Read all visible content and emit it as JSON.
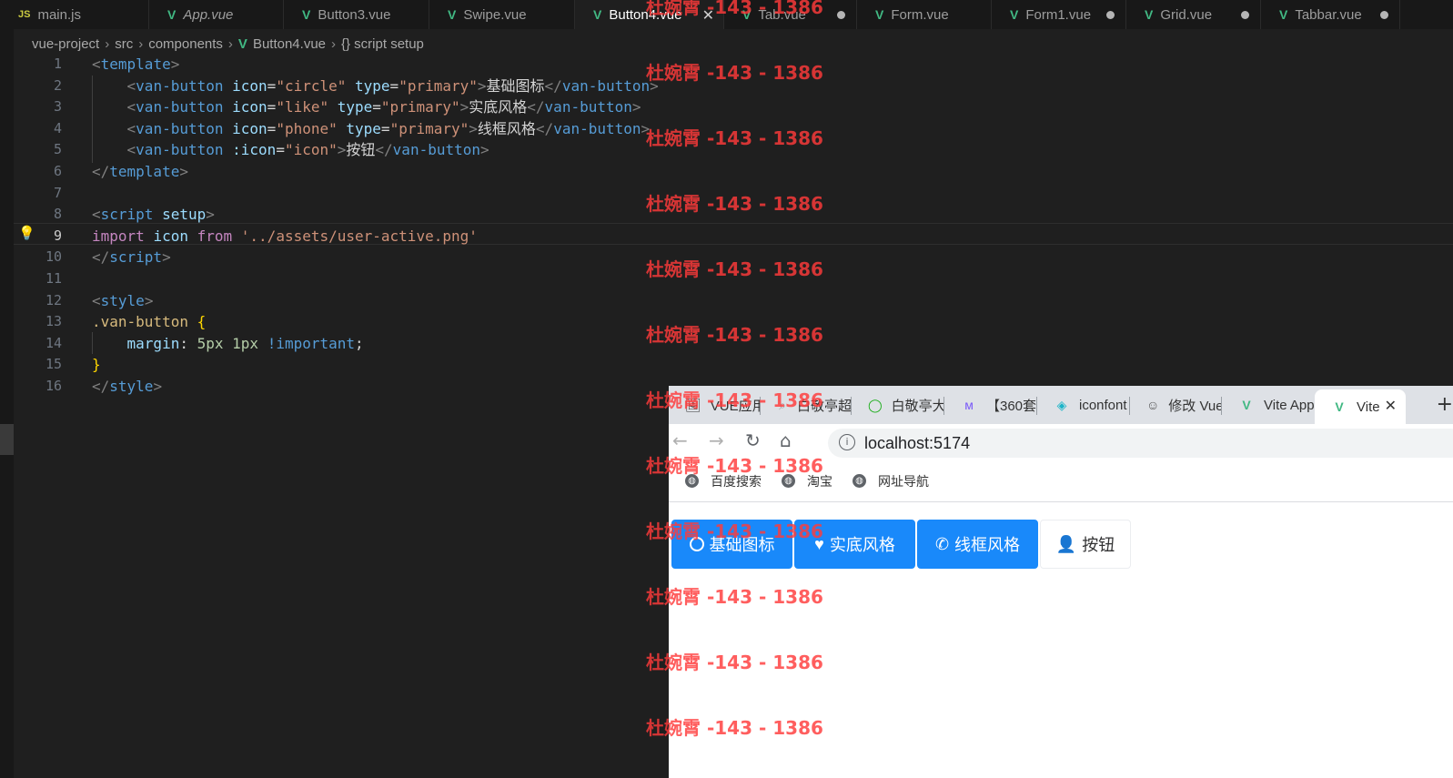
{
  "editor_tabs": [
    {
      "label": "main.js",
      "icon": "js-icon",
      "italic": false,
      "active": false,
      "modified": false
    },
    {
      "label": "App.vue",
      "icon": "vue-icon",
      "italic": true,
      "active": false,
      "modified": false
    },
    {
      "label": "Button3.vue",
      "icon": "vue-icon",
      "italic": false,
      "active": false,
      "modified": false
    },
    {
      "label": "Swipe.vue",
      "icon": "vue-icon",
      "italic": false,
      "active": false,
      "modified": false
    },
    {
      "label": "Button4.vue",
      "icon": "vue-icon",
      "italic": false,
      "active": true,
      "modified": false
    },
    {
      "label": "Tab.vue",
      "icon": "vue-icon",
      "italic": false,
      "active": false,
      "modified": true
    },
    {
      "label": "Form.vue",
      "icon": "vue-icon",
      "italic": false,
      "active": false,
      "modified": false
    },
    {
      "label": "Form1.vue",
      "icon": "vue-icon",
      "italic": false,
      "active": false,
      "modified": true
    },
    {
      "label": "Grid.vue",
      "icon": "vue-icon",
      "italic": false,
      "active": false,
      "modified": true
    },
    {
      "label": "Tabbar.vue",
      "icon": "vue-icon",
      "italic": false,
      "active": false,
      "modified": true
    }
  ],
  "js_icon_text": "JS",
  "vue_icon_text": "V",
  "breadcrumb": {
    "parts": [
      "vue-project",
      "src",
      "components",
      "Button4.vue",
      "{} script setup"
    ]
  },
  "code": {
    "current_line": 9,
    "lines": [
      [
        [
          "tg",
          "<"
        ],
        [
          "tn",
          "template"
        ],
        [
          "tg",
          ">"
        ]
      ],
      [
        [
          "tx",
          "    "
        ],
        [
          "tg",
          "<"
        ],
        [
          "tn",
          "van-button"
        ],
        [
          "tx",
          " "
        ],
        [
          "at",
          "icon"
        ],
        [
          "tx",
          "="
        ],
        [
          "st",
          "\"circle\""
        ],
        [
          "tx",
          " "
        ],
        [
          "at",
          "type"
        ],
        [
          "tx",
          "="
        ],
        [
          "st",
          "\"primary\""
        ],
        [
          "tg",
          ">"
        ],
        [
          "tx",
          "基础图标"
        ],
        [
          "tg",
          "</"
        ],
        [
          "tn",
          "van-button"
        ],
        [
          "tg",
          ">"
        ]
      ],
      [
        [
          "tx",
          "    "
        ],
        [
          "tg",
          "<"
        ],
        [
          "tn",
          "van-button"
        ],
        [
          "tx",
          " "
        ],
        [
          "at",
          "icon"
        ],
        [
          "tx",
          "="
        ],
        [
          "st",
          "\"like\""
        ],
        [
          "tx",
          " "
        ],
        [
          "at",
          "type"
        ],
        [
          "tx",
          "="
        ],
        [
          "st",
          "\"primary\""
        ],
        [
          "tg",
          ">"
        ],
        [
          "tx",
          "实底风格"
        ],
        [
          "tg",
          "</"
        ],
        [
          "tn",
          "van-button"
        ],
        [
          "tg",
          ">"
        ]
      ],
      [
        [
          "tx",
          "    "
        ],
        [
          "tg",
          "<"
        ],
        [
          "tn",
          "van-button"
        ],
        [
          "tx",
          " "
        ],
        [
          "at",
          "icon"
        ],
        [
          "tx",
          "="
        ],
        [
          "st",
          "\"phone\""
        ],
        [
          "tx",
          " "
        ],
        [
          "at",
          "type"
        ],
        [
          "tx",
          "="
        ],
        [
          "st",
          "\"primary\""
        ],
        [
          "tg",
          ">"
        ],
        [
          "tx",
          "线框风格"
        ],
        [
          "tg",
          "</"
        ],
        [
          "tn",
          "van-button"
        ],
        [
          "tg",
          ">"
        ]
      ],
      [
        [
          "tx",
          "    "
        ],
        [
          "tg",
          "<"
        ],
        [
          "tn",
          "van-button"
        ],
        [
          "tx",
          " "
        ],
        [
          "at",
          ":icon"
        ],
        [
          "tx",
          "="
        ],
        [
          "st",
          "\"icon\""
        ],
        [
          "tg",
          ">"
        ],
        [
          "tx",
          "按钮"
        ],
        [
          "tg",
          "</"
        ],
        [
          "tn",
          "van-button"
        ],
        [
          "tg",
          ">"
        ]
      ],
      [
        [
          "tg",
          "</"
        ],
        [
          "tn",
          "template"
        ],
        [
          "tg",
          ">"
        ]
      ],
      [],
      [
        [
          "tg",
          "<"
        ],
        [
          "tn",
          "script"
        ],
        [
          "tx",
          " "
        ],
        [
          "at",
          "setup"
        ],
        [
          "tg",
          ">"
        ]
      ],
      [
        [
          "kw",
          "import"
        ],
        [
          "tx",
          " "
        ],
        [
          "vr",
          "icon"
        ],
        [
          "tx",
          " "
        ],
        [
          "kw",
          "from"
        ],
        [
          "tx",
          " "
        ],
        [
          "st",
          "'../assets/user-active.png'"
        ]
      ],
      [
        [
          "tg",
          "</"
        ],
        [
          "tn",
          "script"
        ],
        [
          "tg",
          ">"
        ]
      ],
      [],
      [
        [
          "tg",
          "<"
        ],
        [
          "tn",
          "style"
        ],
        [
          "tg",
          ">"
        ]
      ],
      [
        [
          "sel",
          ".van-button"
        ],
        [
          "tx",
          " "
        ],
        [
          "br",
          "{"
        ]
      ],
      [
        [
          "tx",
          "    "
        ],
        [
          "at",
          "margin"
        ],
        [
          "tx",
          ": "
        ],
        [
          "nm",
          "5px"
        ],
        [
          "tx",
          " "
        ],
        [
          "nm",
          "1px"
        ],
        [
          "tx",
          " "
        ],
        [
          "tn",
          "!important"
        ],
        [
          "tx",
          ";"
        ]
      ],
      [
        [
          "br",
          "}"
        ]
      ],
      [
        [
          "tg",
          "</"
        ],
        [
          "tn",
          "style"
        ],
        [
          "tg",
          ">"
        ]
      ]
    ]
  },
  "browser": {
    "tabs": [
      {
        "label": "VUE应用",
        "icon": "image-favicon-icon",
        "active": false
      },
      {
        "label": "白敬亭超",
        "icon": "search-favicon-icon",
        "active": false
      },
      {
        "label": "白敬亭大",
        "icon": "360-favicon-icon",
        "active": false
      },
      {
        "label": "【360套",
        "icon": "ai-favicon-icon",
        "active": false
      },
      {
        "label": "iconfont",
        "icon": "iconfont-favicon-icon",
        "active": false
      },
      {
        "label": "修改 Vue",
        "icon": "avatar-favicon-icon",
        "active": false
      },
      {
        "label": "Vite App",
        "icon": "vite-favicon-icon",
        "active": false
      },
      {
        "label": "Vite",
        "icon": "vite-favicon-icon",
        "active": true
      }
    ],
    "url": "localhost:5174",
    "bookmarks": [
      "百度搜索",
      "淘宝",
      "网址导航"
    ],
    "buttons": [
      {
        "label": "基础图标",
        "type": "primary",
        "icon": "circle-icon"
      },
      {
        "label": "实底风格",
        "type": "primary",
        "icon": "heart-icon"
      },
      {
        "label": "线框风格",
        "type": "primary",
        "icon": "phone-icon"
      },
      {
        "label": "按钮",
        "type": "default",
        "icon": "user-icon"
      }
    ]
  },
  "watermark": "杜婉霄 -143 - 1386",
  "colors": {
    "primary": "#1989fa",
    "vue_green": "#41b883",
    "watermark": "#ff3b3b"
  }
}
